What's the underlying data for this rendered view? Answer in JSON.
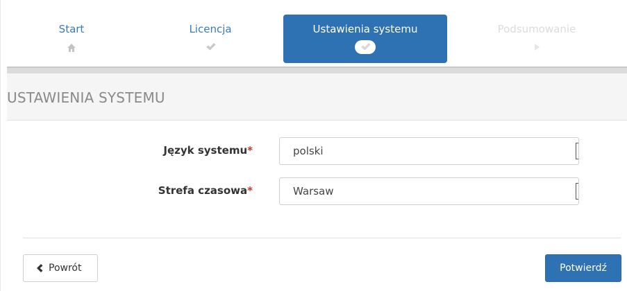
{
  "wizard": {
    "steps": [
      {
        "label": "Start",
        "icon": "home-icon",
        "state": "done"
      },
      {
        "label": "Licencja",
        "icon": "check-icon",
        "state": "done"
      },
      {
        "label": "Ustawienia systemu",
        "icon": "check-icon",
        "state": "active"
      },
      {
        "label": "Podsumowanie",
        "icon": "play-icon",
        "state": "disabled"
      }
    ]
  },
  "section": {
    "title": "USTAWIENIA SYSTEMU"
  },
  "form": {
    "language": {
      "label": "Język systemu",
      "required_mark": "*",
      "value": "polski"
    },
    "timezone": {
      "label": "Strefa czasowa",
      "required_mark": "*",
      "value": "Warsaw"
    }
  },
  "actions": {
    "back_label": "Powrót",
    "confirm_label": "Potwierdź"
  },
  "colors": {
    "accent": "#2f72b3",
    "required": "#d23030",
    "link": "#3a7ab8"
  }
}
